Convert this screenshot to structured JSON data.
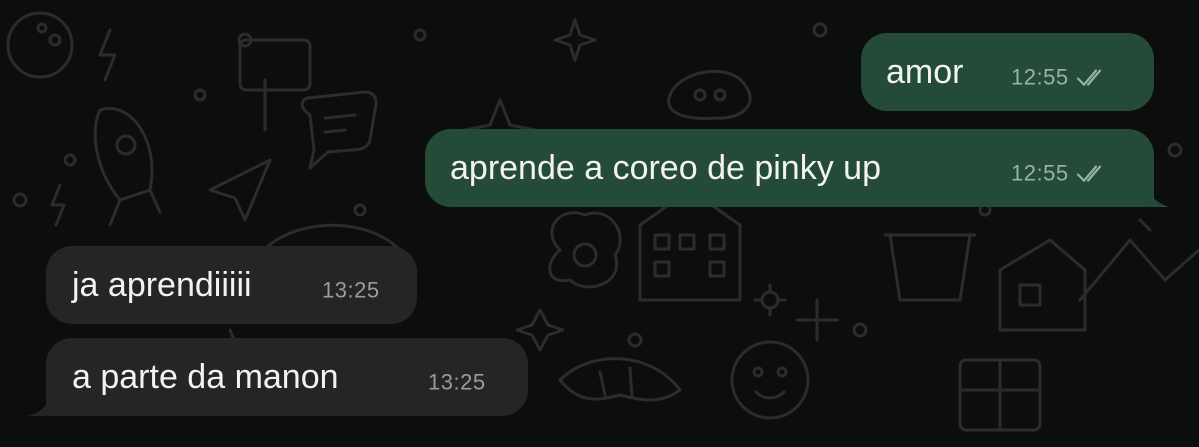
{
  "colors": {
    "background": "#0c0d0d",
    "outgoing_bubble": "#244a38",
    "incoming_bubble": "#242626",
    "message_text": "#f2f2f2",
    "outgoing_meta": "#9bb1a5",
    "incoming_meta": "#9a9c9c"
  },
  "messages": [
    {
      "direction": "outgoing",
      "text": "amor",
      "time": "12:55",
      "status_icon": "double-check-icon"
    },
    {
      "direction": "outgoing",
      "text": "aprende a coreo de pinky up",
      "time": "12:55",
      "status_icon": "double-check-icon"
    },
    {
      "direction": "incoming",
      "text": "ja aprendiiiii",
      "time": "13:25"
    },
    {
      "direction": "incoming",
      "text": "a parte da manon",
      "time": "13:25"
    }
  ]
}
